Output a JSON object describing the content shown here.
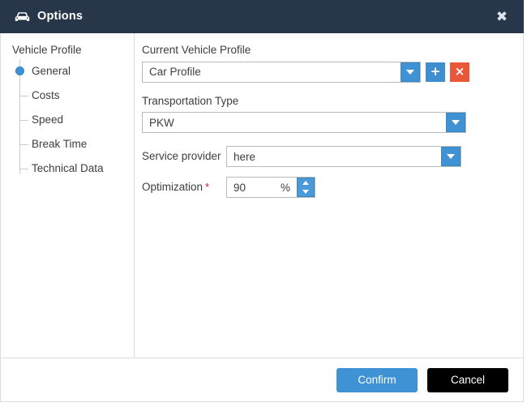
{
  "window": {
    "title": "Options",
    "icon": "car-icon",
    "close_label": "✖"
  },
  "sidebar": {
    "root": "Vehicle Profile",
    "items": [
      {
        "label": "General",
        "selected": true
      },
      {
        "label": "Costs",
        "selected": false
      },
      {
        "label": "Speed",
        "selected": false
      },
      {
        "label": "Break Time",
        "selected": false
      },
      {
        "label": "Technical Data",
        "selected": false
      }
    ]
  },
  "form": {
    "current_profile_label": "Current Vehicle Profile",
    "current_profile_value": "Car Profile",
    "add_profile_label": "+",
    "delete_profile_label": "×",
    "transportation_label": "Transportation Type",
    "transportation_value": "PKW",
    "service_provider_label": "Service provider",
    "service_provider_value": "here",
    "optimization_label": "Optimization",
    "optimization_required_mark": "*",
    "optimization_value": "90",
    "optimization_unit": "%"
  },
  "footer": {
    "confirm_label": "Confirm",
    "cancel_label": "Cancel"
  },
  "colors": {
    "titlebar": "#28364a",
    "accent_blue": "#3f93d4",
    "danger_red": "#e8573a",
    "cancel_black": "#000000",
    "required_red": "#cc1f1f"
  }
}
